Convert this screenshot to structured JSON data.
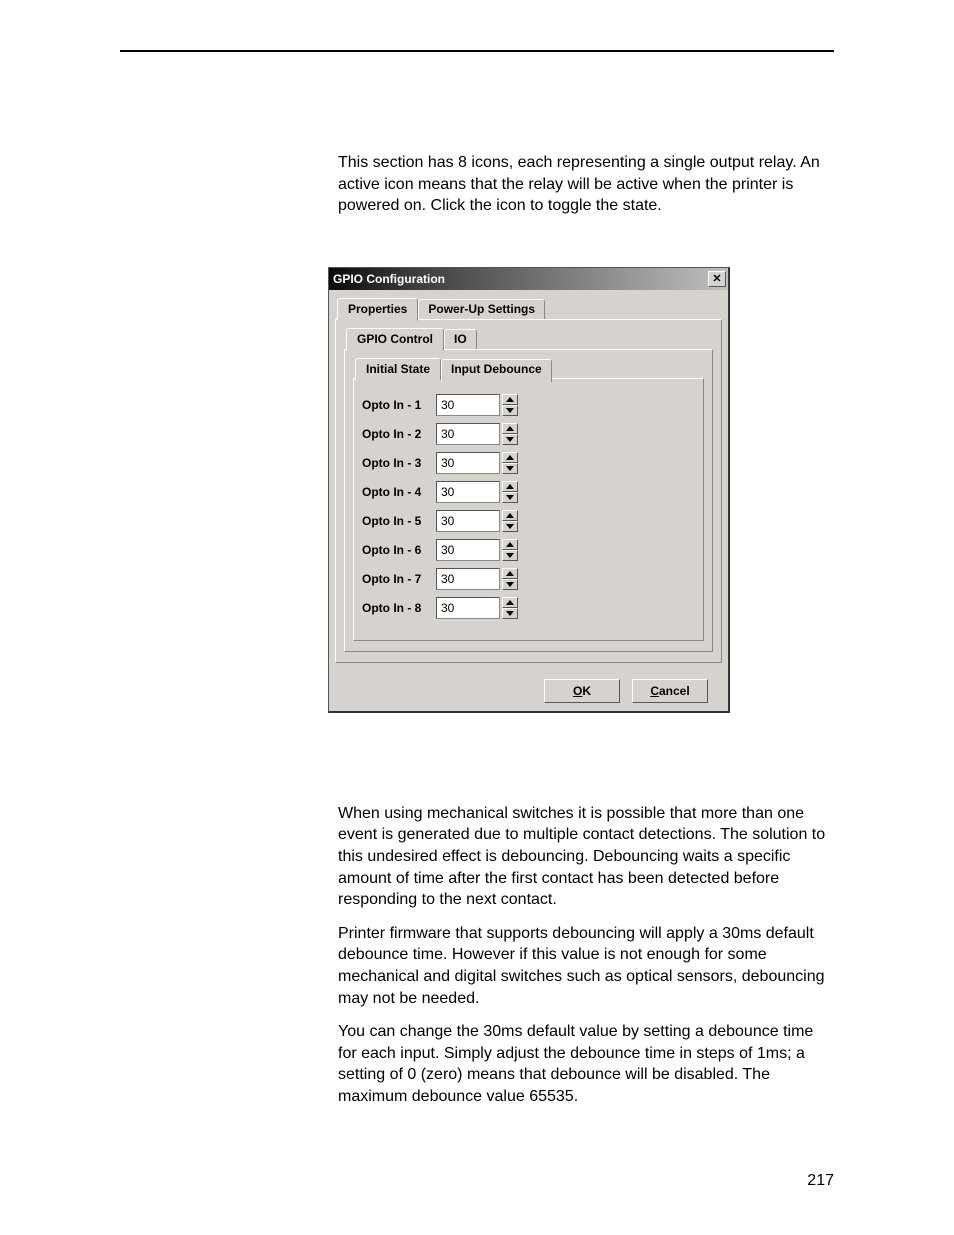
{
  "intro_paragraph": "This section has 8 icons, each representing a single output relay. An active icon means that the relay will be active when the printer is powered on. Click the icon to toggle the state.",
  "dialog": {
    "title": "GPIO Configuration",
    "tabs_row1": {
      "active": "Properties",
      "inactive": "Power-Up Settings"
    },
    "tabs_row2": {
      "active": "GPIO Control",
      "inactive": "IO"
    },
    "tabs_row3": {
      "active": "Initial State",
      "inactive": "Input Debounce"
    },
    "rows": [
      {
        "label": "Opto In - 1",
        "value": "30"
      },
      {
        "label": "Opto In - 2",
        "value": "30"
      },
      {
        "label": "Opto In - 3",
        "value": "30"
      },
      {
        "label": "Opto In - 4",
        "value": "30"
      },
      {
        "label": "Opto In - 5",
        "value": "30"
      },
      {
        "label": "Opto In - 6",
        "value": "30"
      },
      {
        "label": "Opto In - 7",
        "value": "30"
      },
      {
        "label": "Opto In - 8",
        "value": "30"
      }
    ],
    "ok_label": "OK",
    "cancel_label": "Cancel"
  },
  "para2": "When using mechanical switches it is possible that more than one event is generated due to multiple contact detections. The solution to this undesired effect is debouncing. Debouncing waits a specific amount of time after the first contact has been detected before responding to the next contact.",
  "para3": "Printer firmware that supports debouncing will apply a 30ms default debounce time. However if this value is not enough for some mechanical and digital switches such as optical sensors, debouncing may not be needed.",
  "para4": "You can change the 30ms default value by setting a debounce time for each input. Simply adjust the debounce time in steps of 1ms; a setting of 0 (zero) means that debounce will be disabled. The maximum debounce value 65535.",
  "page_number": "217"
}
